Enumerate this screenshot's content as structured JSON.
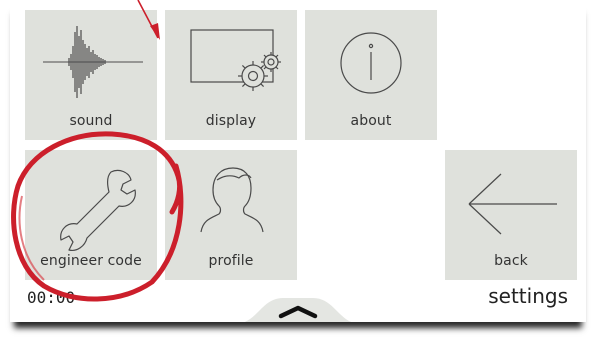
{
  "tiles": {
    "sound": {
      "label": "sound"
    },
    "display": {
      "label": "display"
    },
    "about": {
      "label": "about"
    },
    "engineer_code": {
      "label": "engineer code"
    },
    "profile": {
      "label": "profile"
    },
    "back": {
      "label": "back"
    }
  },
  "status": {
    "time": "00:00",
    "title": "settings"
  },
  "colors": {
    "tile_bg": "#dfe1dc",
    "icon_stroke": "#4a4a4a",
    "annotation": "#cc1f2b"
  },
  "icons": [
    "waveform-icon",
    "display-gears-icon",
    "info-icon",
    "wrench-icon",
    "person-silhouette-icon",
    "arrow-left-icon",
    "chevron-up-icon"
  ]
}
